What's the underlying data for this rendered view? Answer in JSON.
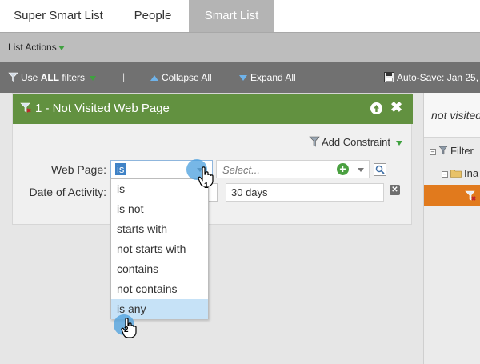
{
  "tabs": [
    {
      "label": "Super Smart List",
      "active": false
    },
    {
      "label": "People",
      "active": false
    },
    {
      "label": "Smart List",
      "active": true
    }
  ],
  "actions_bar": {
    "list_actions_label": "List Actions"
  },
  "toolbar": {
    "use_prefix": "Use",
    "use_bold": "ALL",
    "use_suffix": "filters",
    "separator": "|",
    "collapse_all": "Collapse All",
    "expand_all": "Expand All",
    "autosave": "Auto-Save: Jan 25,"
  },
  "filter_card": {
    "title": "1 - Not Visited Web Page",
    "add_constraint": "Add Constraint",
    "web_page_label": "Web Page:",
    "date_label": "Date of Activity:",
    "operator_value": "is",
    "select_placeholder": "Select...",
    "date_value": "30 days"
  },
  "dropdown": {
    "options": [
      "is",
      "is not",
      "starts with",
      "not starts with",
      "contains",
      "not contains",
      "is any"
    ],
    "highlighted": "is any"
  },
  "right_panel": {
    "header": "not visited",
    "tree_filters": "Filter",
    "tree_sub": "Ina"
  },
  "markers": {
    "first": "1",
    "second": "2"
  },
  "colors": {
    "header_green": "#629140",
    "toolbar_gray": "#717171",
    "active_tab": "#b4b4b4",
    "selection_orange": "#e17a1d",
    "hover_blue": "#c6e2f7"
  }
}
